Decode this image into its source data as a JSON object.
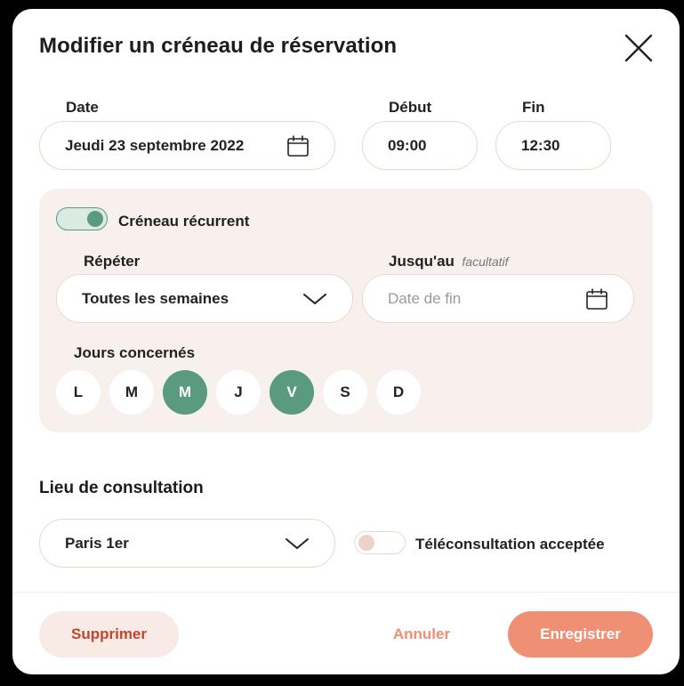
{
  "modal": {
    "title": "Modifier un créneau de réservation"
  },
  "date": {
    "label": "Date",
    "value": "Jeudi 23 septembre 2022"
  },
  "start": {
    "label": "Début",
    "value": "09:00"
  },
  "end": {
    "label": "Fin",
    "value": "12:30"
  },
  "recurrence": {
    "toggle_label": "Créneau récurrent",
    "enabled": true,
    "repeat_label": "Répéter",
    "repeat_value": "Toutes les semaines",
    "until_label": "Jusqu'au",
    "until_optional": "facultatif",
    "until_placeholder": "Date de fin",
    "days_label": "Jours concernés",
    "days": [
      {
        "letter": "L",
        "active": false
      },
      {
        "letter": "M",
        "active": false
      },
      {
        "letter": "M",
        "active": true
      },
      {
        "letter": "J",
        "active": false
      },
      {
        "letter": "V",
        "active": true
      },
      {
        "letter": "S",
        "active": false
      },
      {
        "letter": "D",
        "active": false
      }
    ]
  },
  "location": {
    "section_title": "Lieu de consultation",
    "value": "Paris 1er",
    "teleconsult_label": "Téléconsultation acceptée",
    "teleconsult_enabled": false
  },
  "footer": {
    "delete_label": "Supprimer",
    "cancel_label": "Annuler",
    "save_label": "Enregistrer"
  },
  "colors": {
    "accent_green": "#5a9a7e",
    "accent_salmon": "#ef8f73",
    "danger_text": "#c0462c",
    "panel_bg": "#f8f0ec",
    "field_border": "#ecd8cc"
  }
}
